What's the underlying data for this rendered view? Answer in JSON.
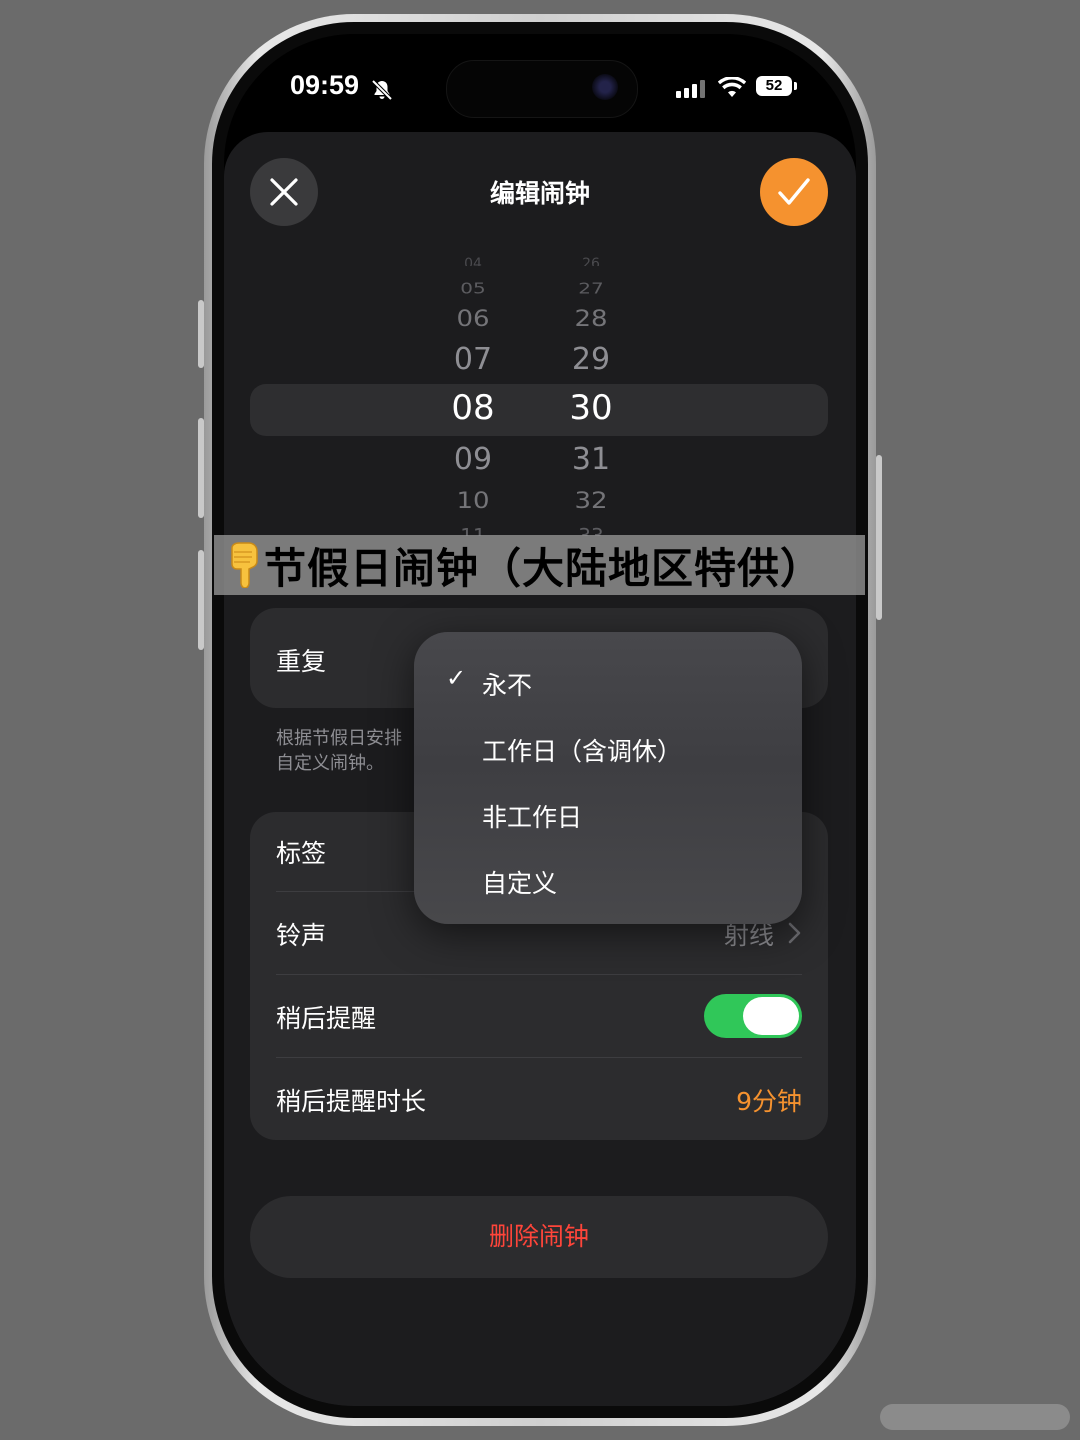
{
  "status_bar": {
    "time": "09:59",
    "battery": "52",
    "icons": [
      "bell-slash-icon",
      "cellular-signal-icon",
      "wifi-icon",
      "battery-icon"
    ]
  },
  "header": {
    "title": "编辑闹钟",
    "close_icon": "close-icon",
    "confirm_icon": "checkmark-icon",
    "accent_color": "#f5922f"
  },
  "picker": {
    "hours": [
      "04",
      "05",
      "06",
      "07",
      "08",
      "09",
      "10",
      "11"
    ],
    "minutes": [
      "26",
      "27",
      "28",
      "29",
      "30",
      "31",
      "32",
      "33"
    ],
    "selected_hour": "08",
    "selected_minute": "30"
  },
  "banner": {
    "emoji_icon": "pointing-down-hand-icon",
    "text": "节假日闹钟（大陆地区特供）"
  },
  "repeat": {
    "label": "重复",
    "footnote_line1": "根据节假日安排",
    "footnote_line2": "自定义闹钟。"
  },
  "settings": {
    "label_row": {
      "label": "标签"
    },
    "ringtone_row": {
      "label": "铃声",
      "value": "射线"
    },
    "snooze_row": {
      "label": "稍后提醒",
      "enabled": true
    },
    "snooze_duration_row": {
      "label": "稍后提醒时长",
      "value": "9分钟"
    }
  },
  "delete_button": {
    "label": "删除闹钟",
    "color": "#ff453a"
  },
  "repeat_menu": {
    "items": [
      {
        "label": "永不",
        "checked": true
      },
      {
        "label": "工作日（含调休）",
        "checked": false
      },
      {
        "label": "非工作日",
        "checked": false
      },
      {
        "label": "自定义",
        "checked": false
      }
    ],
    "check_mark": "✓"
  },
  "colors": {
    "background": "#6b6b6b",
    "sheet": "#1c1c1e",
    "cell": "#2c2c2e",
    "toggle_on": "#30c759"
  }
}
